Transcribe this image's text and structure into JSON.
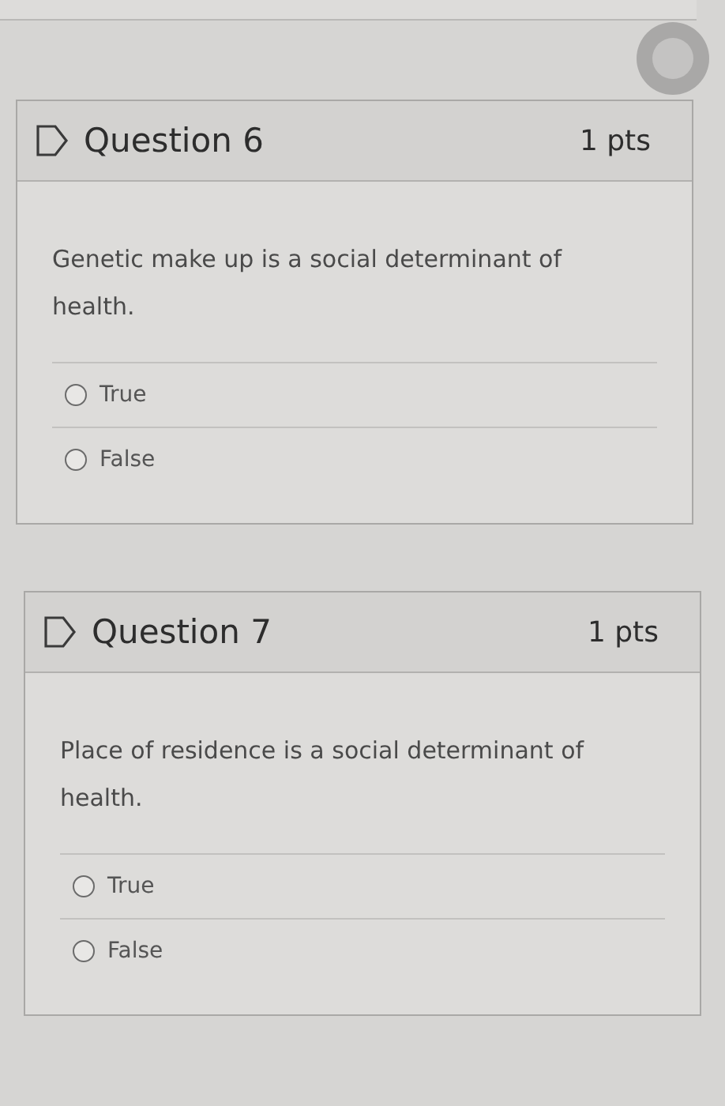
{
  "questions": [
    {
      "title": "Question 6",
      "points": "1 pts",
      "text": "Genetic make up is a social determinant of health.",
      "answers": [
        {
          "label": "True",
          "selected": false
        },
        {
          "label": "False",
          "selected": false
        }
      ]
    },
    {
      "title": "Question 7",
      "points": "1 pts",
      "text": "Place of residence is a social determinant of health.",
      "answers": [
        {
          "label": "True",
          "selected": false
        },
        {
          "label": "False",
          "selected": false
        }
      ]
    }
  ]
}
